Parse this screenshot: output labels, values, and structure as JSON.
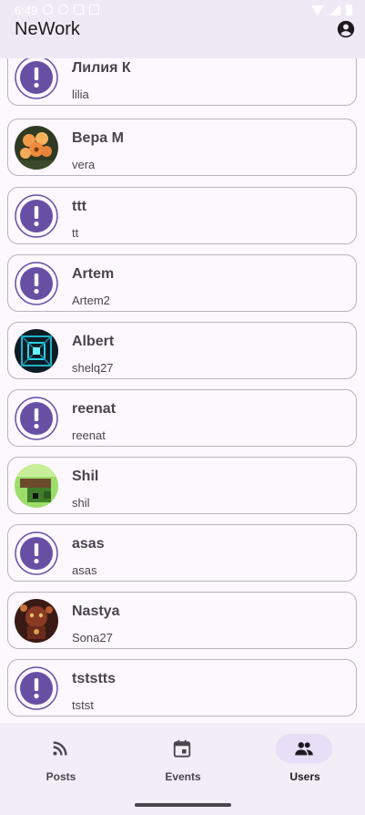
{
  "status_bar": {
    "time": "6:49"
  },
  "app_bar": {
    "title": "NeWork",
    "account_icon": "account-circle-icon"
  },
  "users": [
    {
      "name": "Лилия К",
      "login": "lilia",
      "avatar": "placeholder"
    },
    {
      "name": "Вера М",
      "login": "vera",
      "avatar": "flowers"
    },
    {
      "name": "ttt",
      "login": "tt",
      "avatar": "placeholder"
    },
    {
      "name": "Artem",
      "login": "Artem2",
      "avatar": "placeholder"
    },
    {
      "name": "Albert",
      "login": "shelq27",
      "avatar": "tunnel"
    },
    {
      "name": "reenat",
      "login": "reenat",
      "avatar": "placeholder"
    },
    {
      "name": "Shil",
      "login": "shil",
      "avatar": "pixel"
    },
    {
      "name": "asas",
      "login": "asas",
      "avatar": "placeholder"
    },
    {
      "name": "Nastya",
      "login": "Sona27",
      "avatar": "painting"
    },
    {
      "name": "tststts",
      "login": "tstst",
      "avatar": "placeholder"
    }
  ],
  "bottom_nav": {
    "items": [
      {
        "label": "Posts",
        "icon": "rss-feed-icon",
        "active": false
      },
      {
        "label": "Events",
        "icon": "calendar-icon",
        "active": false
      },
      {
        "label": "Users",
        "icon": "people-icon",
        "active": true
      }
    ]
  },
  "colors": {
    "accent": "#6750a4",
    "nav_indicator": "#e8def8"
  }
}
